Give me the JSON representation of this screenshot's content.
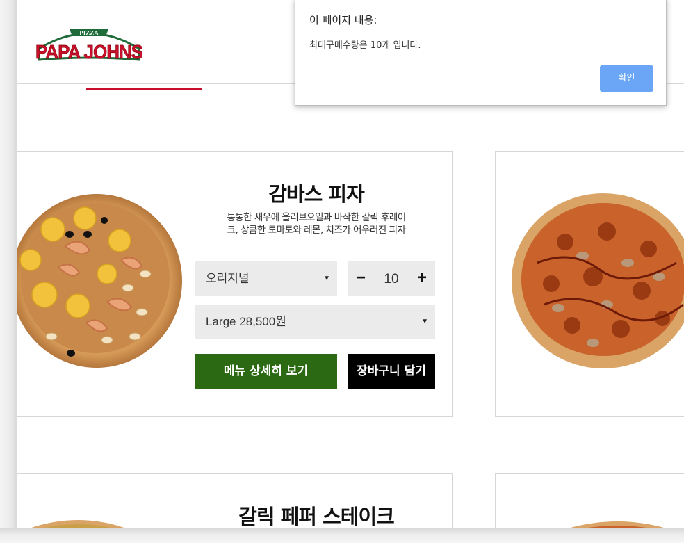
{
  "brand": {
    "logo_top": "PIZZA",
    "logo_main": "PAPA JOHNS",
    "colors": {
      "red": "#c8102e",
      "green": "#1f6b3a",
      "dialog_button": "#6aa6f5"
    }
  },
  "dialog": {
    "title": "이 페이지 내용:",
    "message": "최대구매수량은 10개 입니다.",
    "ok_label": "확인"
  },
  "products": [
    {
      "title": "감바스 피자",
      "description_line1": "통통한 새우에 올리브오일과 바삭한 갈릭 후레이",
      "description_line2": "크, 상큼한 토마토와 레몬, 치즈가 어우러진 피자",
      "dough_option": "오리지널",
      "quantity": "10",
      "size_option": "Large 28,500원",
      "detail_button": "메뉴 상세히 보기",
      "cart_button": "장바구니 담기",
      "minus_symbol": "−",
      "plus_symbol": "+"
    },
    {
      "title": "갈릭 페퍼 스테이크"
    }
  ],
  "icons": {
    "caret": "▼"
  }
}
